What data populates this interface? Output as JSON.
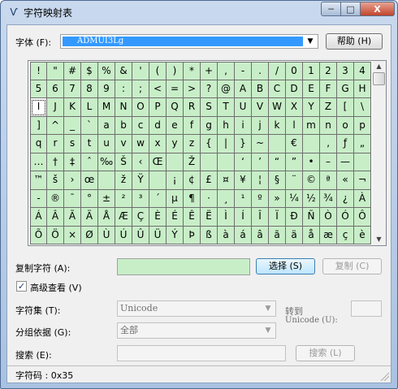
{
  "window": {
    "title": "字符映射表",
    "icon": "charmap-icon",
    "min_label": "─",
    "max_label": "□",
    "close_label": "X"
  },
  "font": {
    "label": "字体 (F):",
    "value": "ADMUI3Lg",
    "help_label": "帮助 (H)"
  },
  "grid": {
    "selected_index": 40,
    "rows": [
      [
        "!",
        "\"",
        "#",
        "$",
        "%",
        "&",
        "'",
        "(",
        ")",
        "*",
        "+",
        ",",
        "-",
        ".",
        "/",
        "0",
        "1",
        "2",
        "3",
        "4"
      ],
      [
        "5",
        "6",
        "7",
        "8",
        "9",
        ":",
        ";",
        "<",
        "=",
        ">",
        "?",
        "@",
        "A",
        "B",
        "C",
        "D",
        "E",
        "F",
        "G",
        "H"
      ],
      [
        "I",
        "J",
        "K",
        "L",
        "M",
        "N",
        "O",
        "P",
        "Q",
        "R",
        "S",
        "T",
        "U",
        "V",
        "W",
        "X",
        "Y",
        "Z",
        "[",
        "\\"
      ],
      [
        "]",
        "^",
        "_",
        "`",
        "a",
        "b",
        "c",
        "d",
        "e",
        "f",
        "g",
        "h",
        "i",
        "j",
        "k",
        "l",
        "m",
        "n",
        "o",
        "p"
      ],
      [
        "q",
        "r",
        "s",
        "t",
        "u",
        "v",
        "w",
        "x",
        "y",
        "z",
        "{",
        "|",
        "}",
        "~",
        "",
        "€",
        "",
        "‚",
        "ƒ",
        "„"
      ],
      [
        "…",
        "†",
        "‡",
        "ˆ",
        "‰",
        "Š",
        "‹",
        "Œ",
        "",
        "Ž",
        "",
        "",
        "‘",
        "’",
        "“",
        "”",
        "•",
        "–",
        "—",
        ""
      ],
      [
        "™",
        "š",
        "›",
        "œ",
        "",
        "ž",
        "Ÿ",
        "",
        "¡",
        "¢",
        "£",
        "¤",
        "¥",
        "¦",
        "§",
        "¨",
        "©",
        "ª",
        "«",
        "¬"
      ],
      [
        "-",
        "®",
        "¯",
        "°",
        "±",
        "²",
        "³",
        "´",
        "µ",
        "¶",
        "·",
        "¸",
        "¹",
        "º",
        "»",
        "¼",
        "½",
        "¾",
        "¿",
        "À"
      ],
      [
        "Á",
        "Â",
        "Ã",
        "Ä",
        "Å",
        "Æ",
        "Ç",
        "È",
        "É",
        "Ê",
        "Ë",
        "Ì",
        "Í",
        "Î",
        "Ï",
        "Ð",
        "Ñ",
        "Ò",
        "Ó",
        "Ô"
      ],
      [
        "Õ",
        "Ö",
        "×",
        "Ø",
        "Ù",
        "Ú",
        "Û",
        "Ü",
        "Ý",
        "Þ",
        "ß",
        "à",
        "á",
        "â",
        "ã",
        "ä",
        "å",
        "æ",
        "ç",
        "è"
      ]
    ]
  },
  "copy": {
    "label": "复制字符 (A):",
    "value": "",
    "select_label": "选择 (S)",
    "copy_label": "复制 (C)"
  },
  "advanced": {
    "label": "高级查看 (V)",
    "checked": "✓"
  },
  "charset": {
    "label": "字符集 (T):",
    "value": "Unicode",
    "goto_label_1": "转到",
    "goto_label_2": "Unicode (U):"
  },
  "groupby": {
    "label": "分组依据 (G):",
    "value": "全部"
  },
  "search": {
    "label": "搜索 (E):",
    "button_label": "搜索 (L)"
  },
  "status": {
    "text": "字符码 : 0x35"
  },
  "icons": {
    "dropdown": "▼",
    "scroll_up": "▲",
    "scroll_down": "▼"
  }
}
